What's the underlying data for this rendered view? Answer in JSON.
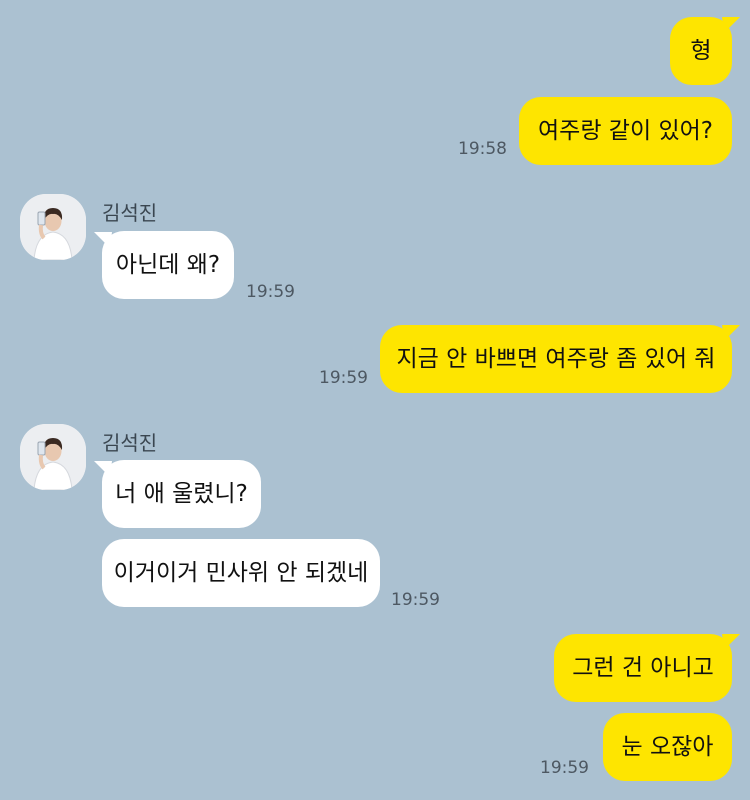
{
  "colors": {
    "background": "#abc1d1",
    "my_bubble": "#fee500",
    "their_bubble": "#ffffff"
  },
  "chat": {
    "contact_name": "김석진",
    "messages": [
      {
        "from": "me",
        "text": "형"
      },
      {
        "from": "me",
        "text": "여주랑 같이 있어?",
        "time": "19:58"
      },
      {
        "from": "them",
        "sender": "김석진",
        "text": "아닌데 왜?",
        "time": "19:59"
      },
      {
        "from": "me",
        "text": "지금 안 바쁘면 여주랑 좀 있어 줘",
        "time": "19:59"
      },
      {
        "from": "them",
        "sender": "김석진",
        "text": "너 애 울렸니?"
      },
      {
        "from": "them",
        "text": "이거이거 민사위 안 되겠네",
        "time": "19:59"
      },
      {
        "from": "me",
        "text": "그런 건 아니고"
      },
      {
        "from": "me",
        "text": "눈 오잖아",
        "time": "19:59"
      }
    ]
  }
}
